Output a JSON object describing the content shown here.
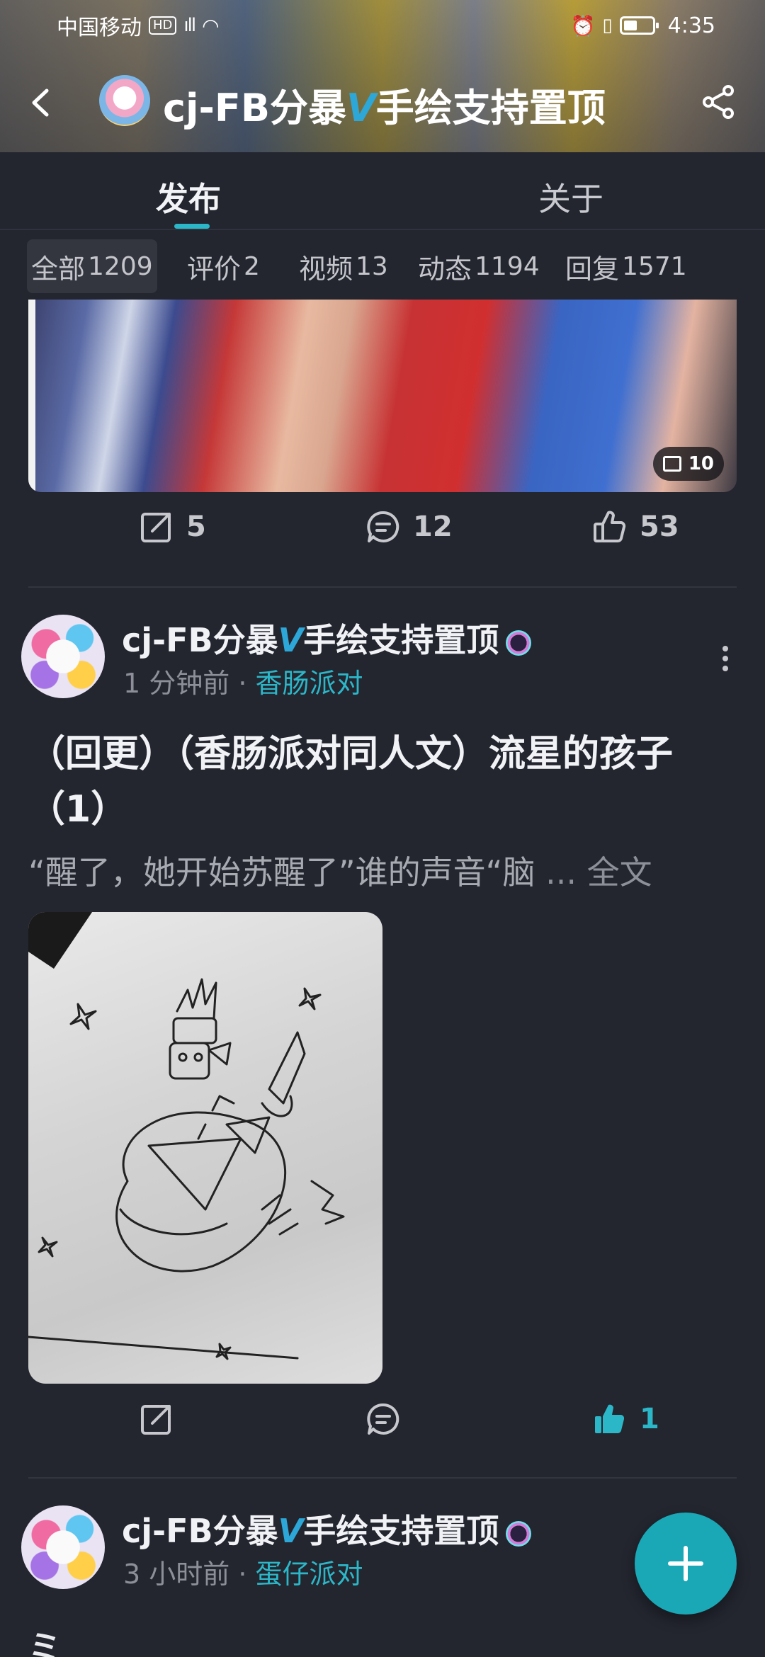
{
  "status_bar": {
    "carrier": "中国移动",
    "hd": "HD",
    "network": "4G",
    "time": "4:35"
  },
  "header": {
    "title_prefix": "cj-FB分暴",
    "title_v": "V",
    "title_suffix": "手绘支持置顶"
  },
  "tabs": [
    {
      "label": "发布",
      "active": true
    },
    {
      "label": "关于",
      "active": false
    }
  ],
  "filters": [
    {
      "label": "全部",
      "count": "1209",
      "active": true
    },
    {
      "label": "评价",
      "count": "2"
    },
    {
      "label": "视频",
      "count": "13"
    },
    {
      "label": "动态",
      "count": "1194"
    },
    {
      "label": "回复",
      "count": "1571"
    }
  ],
  "prev_post": {
    "image_count": "10",
    "shares": "5",
    "comments": "12",
    "likes": "53"
  },
  "post1": {
    "author_prefix": "cj-FB分暴",
    "author_v": "V",
    "author_suffix": "手绘支持置顶",
    "time": "1 分钟前",
    "separator": "·",
    "topic": "香肠派对",
    "title": "（回更）（香肠派对同人文）流星的孩子（1）",
    "excerpt": "“醒了，她开始苏醒了”谁的声音“脑",
    "excerpt_more": "...",
    "full_text": "全文",
    "likes": "1"
  },
  "post2": {
    "author_prefix": "cj-FB分暴",
    "author_v": "V",
    "author_suffix": "手绘支持置顶",
    "time": "3 小时前",
    "separator": "·",
    "topic": "蛋仔派对",
    "text_start": "ミ"
  },
  "colors": {
    "accent": "#2cb7c8",
    "background": "#23252f",
    "fab": "#1aa8b6"
  }
}
